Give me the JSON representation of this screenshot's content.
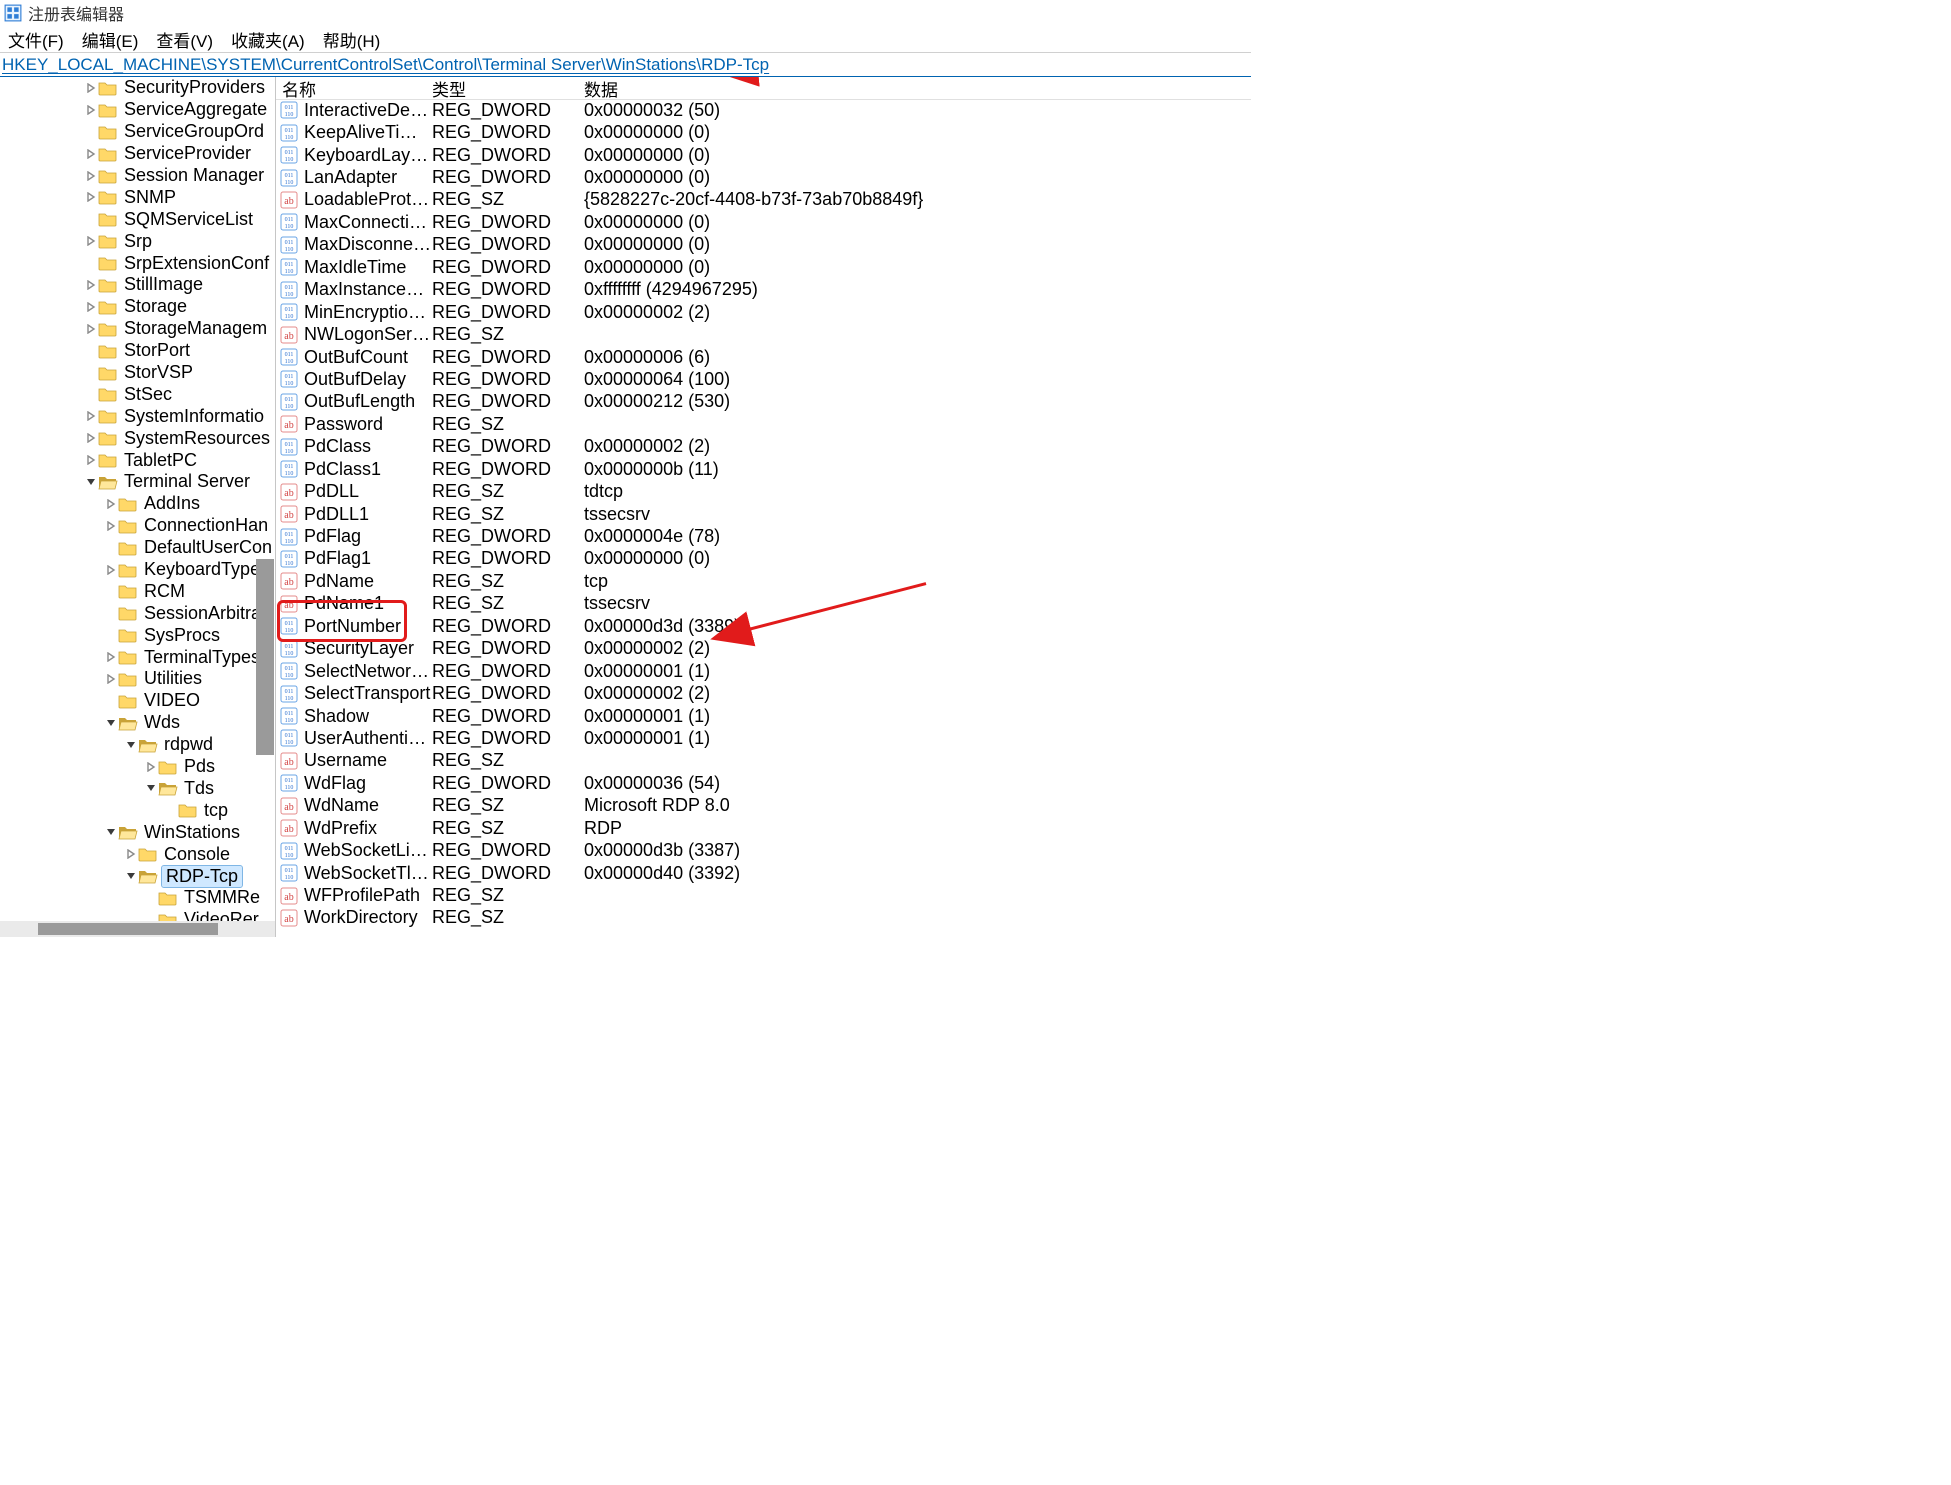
{
  "title": "注册表编辑器",
  "menu": {
    "file": "文件(F)",
    "edit": "编辑(E)",
    "view": "查看(V)",
    "fav": "收藏夹(A)",
    "help": "帮助(H)"
  },
  "address_bar": "HKEY_LOCAL_MACHINE\\SYSTEM\\CurrentControlSet\\Control\\Terminal Server\\WinStations\\RDP-Tcp",
  "columns": {
    "name": "名称",
    "type": "类型",
    "data": "数据"
  },
  "tree": [
    {
      "depth": 0,
      "expander": ">",
      "open": false,
      "label": "SecurityProviders"
    },
    {
      "depth": 0,
      "expander": ">",
      "open": false,
      "label": "ServiceAggregate"
    },
    {
      "depth": 0,
      "expander": "",
      "open": false,
      "label": "ServiceGroupOrd"
    },
    {
      "depth": 0,
      "expander": ">",
      "open": false,
      "label": "ServiceProvider"
    },
    {
      "depth": 0,
      "expander": ">",
      "open": false,
      "label": "Session Manager"
    },
    {
      "depth": 0,
      "expander": ">",
      "open": false,
      "label": "SNMP"
    },
    {
      "depth": 0,
      "expander": "",
      "open": false,
      "label": "SQMServiceList"
    },
    {
      "depth": 0,
      "expander": ">",
      "open": false,
      "label": "Srp"
    },
    {
      "depth": 0,
      "expander": "",
      "open": false,
      "label": "SrpExtensionConf"
    },
    {
      "depth": 0,
      "expander": ">",
      "open": false,
      "label": "StillImage"
    },
    {
      "depth": 0,
      "expander": ">",
      "open": false,
      "label": "Storage"
    },
    {
      "depth": 0,
      "expander": ">",
      "open": false,
      "label": "StorageManagem"
    },
    {
      "depth": 0,
      "expander": "",
      "open": false,
      "label": "StorPort"
    },
    {
      "depth": 0,
      "expander": "",
      "open": false,
      "label": "StorVSP"
    },
    {
      "depth": 0,
      "expander": "",
      "open": false,
      "label": "StSec"
    },
    {
      "depth": 0,
      "expander": ">",
      "open": false,
      "label": "SystemInformatio"
    },
    {
      "depth": 0,
      "expander": ">",
      "open": false,
      "label": "SystemResources"
    },
    {
      "depth": 0,
      "expander": ">",
      "open": false,
      "label": "TabletPC"
    },
    {
      "depth": 0,
      "expander": "v",
      "open": true,
      "label": "Terminal Server"
    },
    {
      "depth": 1,
      "expander": ">",
      "open": false,
      "label": "AddIns"
    },
    {
      "depth": 1,
      "expander": ">",
      "open": false,
      "label": "ConnectionHan"
    },
    {
      "depth": 1,
      "expander": "",
      "open": false,
      "label": "DefaultUserCon"
    },
    {
      "depth": 1,
      "expander": ">",
      "open": false,
      "label": "KeyboardType"
    },
    {
      "depth": 1,
      "expander": "",
      "open": false,
      "label": "RCM"
    },
    {
      "depth": 1,
      "expander": "",
      "open": false,
      "label": "SessionArbitrat"
    },
    {
      "depth": 1,
      "expander": "",
      "open": false,
      "label": "SysProcs"
    },
    {
      "depth": 1,
      "expander": ">",
      "open": false,
      "label": "TerminalTypes"
    },
    {
      "depth": 1,
      "expander": ">",
      "open": false,
      "label": "Utilities"
    },
    {
      "depth": 1,
      "expander": "",
      "open": false,
      "label": "VIDEO"
    },
    {
      "depth": 1,
      "expander": "v",
      "open": true,
      "label": "Wds"
    },
    {
      "depth": 2,
      "expander": "v",
      "open": true,
      "label": "rdpwd"
    },
    {
      "depth": 3,
      "expander": ">",
      "open": false,
      "label": "Pds"
    },
    {
      "depth": 3,
      "expander": "v",
      "open": true,
      "label": "Tds"
    },
    {
      "depth": 4,
      "expander": "",
      "open": false,
      "label": "tcp"
    },
    {
      "depth": 1,
      "expander": "v",
      "open": true,
      "label": "WinStations"
    },
    {
      "depth": 2,
      "expander": ">",
      "open": false,
      "label": "Console"
    },
    {
      "depth": 2,
      "expander": "v",
      "open": true,
      "label": "RDP-Tcp",
      "selected": true
    },
    {
      "depth": 3,
      "expander": "",
      "open": false,
      "label": "TSMMRe"
    },
    {
      "depth": 3,
      "expander": "",
      "open": false,
      "label": "VideoRer"
    }
  ],
  "values": [
    {
      "icon": "dword",
      "name": "InteractiveDelay",
      "type": "REG_DWORD",
      "data": "0x00000032 (50)"
    },
    {
      "icon": "dword",
      "name": "KeepAliveTime...",
      "type": "REG_DWORD",
      "data": "0x00000000 (0)"
    },
    {
      "icon": "dword",
      "name": "KeyboardLayout",
      "type": "REG_DWORD",
      "data": "0x00000000 (0)"
    },
    {
      "icon": "dword",
      "name": "LanAdapter",
      "type": "REG_DWORD",
      "data": "0x00000000 (0)"
    },
    {
      "icon": "sz",
      "name": "LoadableProtoc...",
      "type": "REG_SZ",
      "data": "{5828227c-20cf-4408-b73f-73ab70b8849f}"
    },
    {
      "icon": "dword",
      "name": "MaxConnection...",
      "type": "REG_DWORD",
      "data": "0x00000000 (0)"
    },
    {
      "icon": "dword",
      "name": "MaxDisconnecti...",
      "type": "REG_DWORD",
      "data": "0x00000000 (0)"
    },
    {
      "icon": "dword",
      "name": "MaxIdleTime",
      "type": "REG_DWORD",
      "data": "0x00000000 (0)"
    },
    {
      "icon": "dword",
      "name": "MaxInstanceCo...",
      "type": "REG_DWORD",
      "data": "0xffffffff (4294967295)"
    },
    {
      "icon": "dword",
      "name": "MinEncryptionL...",
      "type": "REG_DWORD",
      "data": "0x00000002 (2)"
    },
    {
      "icon": "sz",
      "name": "NWLogonServer",
      "type": "REG_SZ",
      "data": ""
    },
    {
      "icon": "dword",
      "name": "OutBufCount",
      "type": "REG_DWORD",
      "data": "0x00000006 (6)"
    },
    {
      "icon": "dword",
      "name": "OutBufDelay",
      "type": "REG_DWORD",
      "data": "0x00000064 (100)"
    },
    {
      "icon": "dword",
      "name": "OutBufLength",
      "type": "REG_DWORD",
      "data": "0x00000212 (530)"
    },
    {
      "icon": "sz",
      "name": "Password",
      "type": "REG_SZ",
      "data": ""
    },
    {
      "icon": "dword",
      "name": "PdClass",
      "type": "REG_DWORD",
      "data": "0x00000002 (2)"
    },
    {
      "icon": "dword",
      "name": "PdClass1",
      "type": "REG_DWORD",
      "data": "0x0000000b (11)"
    },
    {
      "icon": "sz",
      "name": "PdDLL",
      "type": "REG_SZ",
      "data": "tdtcp"
    },
    {
      "icon": "sz",
      "name": "PdDLL1",
      "type": "REG_SZ",
      "data": "tssecsrv"
    },
    {
      "icon": "dword",
      "name": "PdFlag",
      "type": "REG_DWORD",
      "data": "0x0000004e (78)"
    },
    {
      "icon": "dword",
      "name": "PdFlag1",
      "type": "REG_DWORD",
      "data": "0x00000000 (0)"
    },
    {
      "icon": "sz",
      "name": "PdName",
      "type": "REG_SZ",
      "data": "tcp"
    },
    {
      "icon": "sz",
      "name": "PdName1",
      "type": "REG_SZ",
      "data": "tssecsrv"
    },
    {
      "icon": "dword",
      "name": "PortNumber",
      "type": "REG_DWORD",
      "data": "0x00000d3d (3389)"
    },
    {
      "icon": "dword",
      "name": "SecurityLayer",
      "type": "REG_DWORD",
      "data": "0x00000002 (2)"
    },
    {
      "icon": "dword",
      "name": "SelectNetwork...",
      "type": "REG_DWORD",
      "data": "0x00000001 (1)"
    },
    {
      "icon": "dword",
      "name": "SelectTransport",
      "type": "REG_DWORD",
      "data": "0x00000002 (2)"
    },
    {
      "icon": "dword",
      "name": "Shadow",
      "type": "REG_DWORD",
      "data": "0x00000001 (1)"
    },
    {
      "icon": "dword",
      "name": "UserAuthentica...",
      "type": "REG_DWORD",
      "data": "0x00000001 (1)"
    },
    {
      "icon": "sz",
      "name": "Username",
      "type": "REG_SZ",
      "data": ""
    },
    {
      "icon": "dword",
      "name": "WdFlag",
      "type": "REG_DWORD",
      "data": "0x00000036 (54)"
    },
    {
      "icon": "sz",
      "name": "WdName",
      "type": "REG_SZ",
      "data": "Microsoft RDP 8.0"
    },
    {
      "icon": "sz",
      "name": "WdPrefix",
      "type": "REG_SZ",
      "data": "RDP"
    },
    {
      "icon": "dword",
      "name": "WebSocketListe...",
      "type": "REG_DWORD",
      "data": "0x00000d3b (3387)"
    },
    {
      "icon": "dword",
      "name": "WebSocketTlsLi...",
      "type": "REG_DWORD",
      "data": "0x00000d40 (3392)"
    },
    {
      "icon": "sz",
      "name": "WFProfilePath",
      "type": "REG_SZ",
      "data": ""
    },
    {
      "icon": "sz",
      "name": "WorkDirectory",
      "type": "REG_SZ",
      "data": ""
    }
  ],
  "annotations": {
    "box_target_value": "PortNumber",
    "arrow1_target": "address_bar",
    "arrow2_target": "PortNumber"
  }
}
